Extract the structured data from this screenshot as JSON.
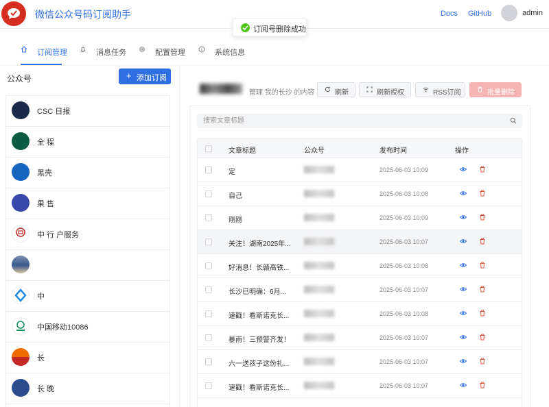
{
  "header": {
    "title": "微信公众号码订阅助手",
    "links": {
      "docs": "Docs",
      "github": "GitHub"
    },
    "user": "admin"
  },
  "toast": {
    "text": "订阅号删除成功"
  },
  "tabs": [
    {
      "label": "订阅管理",
      "icon": "home-icon",
      "active": true
    },
    {
      "label": "消息任务",
      "icon": "bell-icon",
      "active": false
    },
    {
      "label": "配置管理",
      "icon": "gear-icon",
      "active": false
    },
    {
      "label": "系统信息",
      "icon": "info-icon",
      "active": false
    }
  ],
  "left": {
    "title": "公众号",
    "add_button": "添加订阅",
    "accounts": [
      {
        "name": "CSC 日报",
        "color": "#1b2a4a"
      },
      {
        "name": "全 程",
        "color": "#0b5b43"
      },
      {
        "name": "黑壳",
        "color": "#1565c0"
      },
      {
        "name": "果 售",
        "color": "#3949ab"
      },
      {
        "name": "中 行 户服务",
        "color": "#c62828"
      },
      {
        "name": "",
        "color": "#3a5a8c"
      },
      {
        "name": "中",
        "color": "#1e88e5"
      },
      {
        "name": "中国移动10086",
        "color": "#0a8f5a"
      },
      {
        "name": "长",
        "color": "#ef6c00"
      },
      {
        "name": "长 晚",
        "color": "#2b4c8c"
      }
    ]
  },
  "main": {
    "description": "管理 我的长沙 的内容",
    "buttons": {
      "refresh": "刷新",
      "refresh_auth": "刷新授权",
      "rss": "RSS订阅",
      "batch_delete": "批量删除"
    },
    "search_placeholder": "搜索文章标题",
    "columns": [
      "文章标题",
      "公众号",
      "发布时间",
      "操作"
    ],
    "rows": [
      {
        "title": "定 ",
        "time": "2025-06-03 10:09",
        "highlight": false
      },
      {
        "title": "自己 ",
        "time": "2025-06-03 10:08",
        "highlight": false
      },
      {
        "title": "刚刚 ",
        "time": "2025-06-03 10:09",
        "highlight": false
      },
      {
        "title": "关注！湖南2025年...",
        "time": "2025-06-03 10:07",
        "highlight": true
      },
      {
        "title": "好消息！长赣高铁...",
        "time": "2025-06-03 10:08",
        "highlight": false
      },
      {
        "title": "长沙已明确：6月...",
        "time": "2025-06-03 10:07",
        "highlight": false
      },
      {
        "title": "速戳！看斯诺克长...",
        "time": "2025-06-03 10:08",
        "highlight": false
      },
      {
        "title": "暴雨！三预警齐发！",
        "time": "2025-06-03 10:07",
        "highlight": false
      },
      {
        "title": "六一送孩子这份礼...",
        "time": "2025-06-03 10:07",
        "highlight": false
      },
      {
        "title": "速戳！看斯诺克长...",
        "time": "2025-06-03 10:07",
        "highlight": false
      }
    ]
  },
  "colors": {
    "primary": "#2f6fe4",
    "danger": "#f6b3b3",
    "success": "#52c41a",
    "logo": "#d52d1f"
  }
}
